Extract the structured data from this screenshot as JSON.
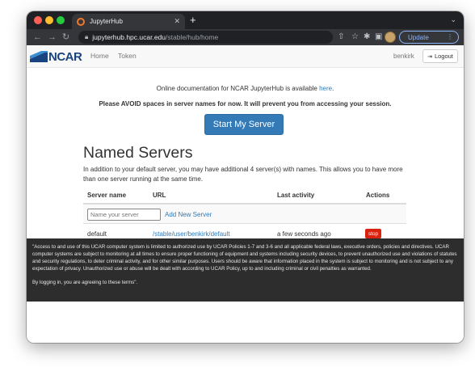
{
  "browser": {
    "tab_title": "JupyterHub",
    "tab_close": "✕",
    "new_tab": "+",
    "tab_search": "⌄",
    "url_host": "jupyterhub.hpc.ucar.edu",
    "url_path": "/stable/hub/home",
    "update_label": "Update",
    "update_menu": "⋮",
    "icons": [
      "back-arrow-icon",
      "forward-arrow-icon",
      "reload-icon",
      "lock-icon",
      "share-icon",
      "star-icon",
      "extensions-icon",
      "sidebar-icon",
      "profile-avatar-icon"
    ]
  },
  "nav": {
    "logo_text": "NCAR",
    "home": "Home",
    "token": "Token",
    "user": "benkirk",
    "logout": "Logout"
  },
  "main": {
    "docs_text": "Online documentation for NCAR JupyterHub is available ",
    "docs_link": "here",
    "docs_end": ".",
    "avoid_text": "Please AVOID spaces in server names for now. It will prevent you from accessing your session.",
    "start_button": "Start My Server",
    "named_title": "Named Servers",
    "named_desc": "In addition to your default server, you may have additional 4 server(s) with names. This allows you to have more than one server running at the same time."
  },
  "table": {
    "headers": [
      "Server name",
      "URL",
      "Last activity",
      "Actions"
    ],
    "input_placeholder": "Name your server",
    "add_server": "Add New Server",
    "rows": [
      {
        "name": "default",
        "url": "/stable/user/benkirk/default",
        "last_activity": "a few seconds ago",
        "action": "stop"
      }
    ]
  },
  "footer": {
    "terms": "\"Access to and use of this UCAR computer system is limited to authorized use by UCAR Policies 1-7 and 3-6 and all applicable federal laws, executive orders, policies and directives. UCAR computer systems are subject to monitoring at all times to ensure proper functioning of equipment and systems including security devices, to prevent unauthorized use and violations of statutes and security regulations, to deter criminal activity, and for other similar purposes. Users should be aware that information placed in the system is subject to monitoring and is not subject to any expectation of privacy. Unauthorized use or abuse will be dealt with according to UCAR Policy, up to and including criminal or civil penalties as warranted.",
    "agree": "By logging in, you are agreeing to these terms\"."
  },
  "colors": {
    "primary_blue": "#337ab7",
    "stop_red": "#d9230f",
    "ncar_blue": "#1a4480",
    "footer_bg": "#2d2d2d"
  }
}
